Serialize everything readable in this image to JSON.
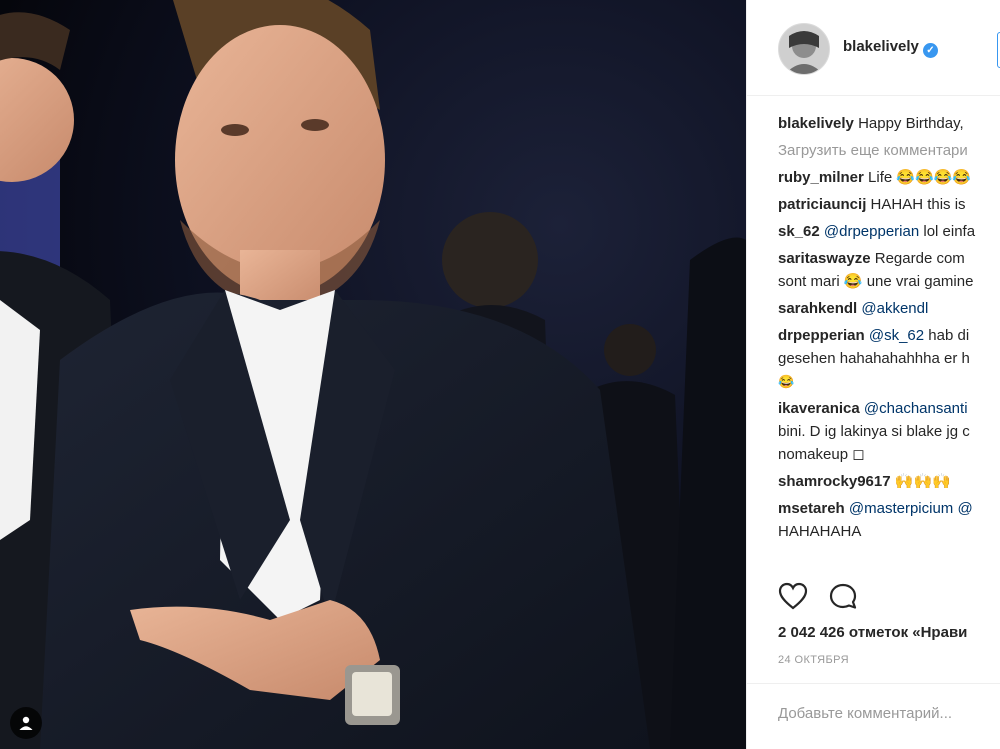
{
  "post": {
    "username": "blakelively",
    "caption": "Happy Birthday,",
    "load_more": "Загрузить еще комментари",
    "likes": "2 042 426 отметок «Нрави",
    "date": "24 ОКТЯБРЯ",
    "add_comment_placeholder": "Добавьте комментарий..."
  },
  "comments": [
    {
      "user": "ruby_milner",
      "text": "Life 😂😂😂😂"
    },
    {
      "user": "patriciauncij",
      "text": "HAHAH this is"
    },
    {
      "user": "sk_62",
      "mention": "@drpepperian",
      "text": "lol einfa"
    },
    {
      "user": "saritaswayze",
      "text": "Regarde com",
      "text2": "sont mari 😂 une vrai gamine"
    },
    {
      "user": "sarahkendl",
      "mention": "@akkendl",
      "text": ""
    },
    {
      "user": "drpepperian",
      "mention": "@sk_62",
      "text": "hab di",
      "text2": "gesehen hahahahahhha er h",
      "text3": "😂"
    },
    {
      "user": "ikaveranica",
      "mention": "@chachansanti",
      "text": "",
      "text2": "bini. D ig lakinya si blake jg c",
      "text3": "nomakeup ◻"
    },
    {
      "user": "shamrocky9617",
      "text": "🙌🙌🙌"
    },
    {
      "user": "msetareh",
      "mention": "@masterpicium",
      "text": " @",
      "text2": "HAHAHAHA"
    }
  ],
  "icons": {
    "tag": "user-tag-icon",
    "like": "heart-icon",
    "comment": "comment-bubble-icon",
    "verified": "verified-badge-icon"
  },
  "colors": {
    "link": "#003569",
    "verified": "#3897f0",
    "muted": "#999999"
  }
}
